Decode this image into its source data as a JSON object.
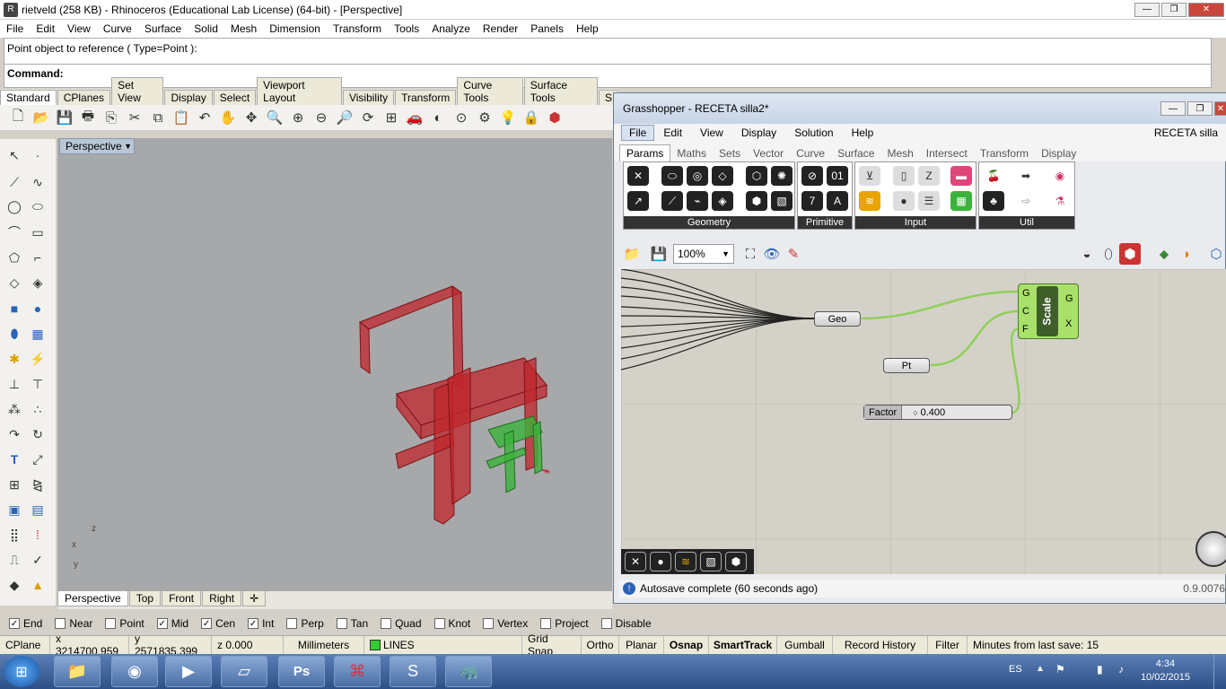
{
  "window": {
    "title": "rietveld (258 KB) - Rhinoceros (Educational Lab License) (64-bit) - [Perspective]"
  },
  "menu": [
    "File",
    "Edit",
    "View",
    "Curve",
    "Surface",
    "Solid",
    "Mesh",
    "Dimension",
    "Transform",
    "Tools",
    "Analyze",
    "Render",
    "Panels",
    "Help"
  ],
  "command": {
    "history": "Point object to reference ( Type=Point ):",
    "prompt": "Command:"
  },
  "toolbar_tabs": [
    "Standard",
    "CPlanes",
    "Set View",
    "Display",
    "Select",
    "Viewport Layout",
    "Visibility",
    "Transform",
    "Curve Tools",
    "Surface Tools",
    "S"
  ],
  "viewport": {
    "title": "Perspective",
    "tabs": [
      "Perspective",
      "Top",
      "Front",
      "Right"
    ],
    "axis_labels": {
      "z": "z",
      "x": "x",
      "y": "y"
    }
  },
  "osnap": [
    {
      "label": "End",
      "checked": true
    },
    {
      "label": "Near",
      "checked": false
    },
    {
      "label": "Point",
      "checked": false
    },
    {
      "label": "Mid",
      "checked": true
    },
    {
      "label": "Cen",
      "checked": true
    },
    {
      "label": "Int",
      "checked": true
    },
    {
      "label": "Perp",
      "checked": false
    },
    {
      "label": "Tan",
      "checked": false
    },
    {
      "label": "Quad",
      "checked": false
    },
    {
      "label": "Knot",
      "checked": false
    },
    {
      "label": "Vertex",
      "checked": false
    },
    {
      "label": "Project",
      "checked": false
    },
    {
      "label": "Disable",
      "checked": false
    }
  ],
  "status": {
    "cplane": "CPlane",
    "x": "x 3214700.959",
    "y": "y 2571835.399",
    "z": "z 0.000",
    "units": "Millimeters",
    "layer": "LINES",
    "layer_color": "#33cc33",
    "grid_snap": "Grid Snap",
    "ortho": "Ortho",
    "planar": "Planar",
    "osnap": "Osnap",
    "smarttrack": "SmartTrack",
    "gumball": "Gumball",
    "record_history": "Record History",
    "filter": "Filter",
    "last_save": "Minutes from last save: 15"
  },
  "grasshopper": {
    "title": "Grasshopper - RECETA silla2*",
    "doc_name": "RECETA silla",
    "menu": [
      "File",
      "Edit",
      "View",
      "Display",
      "Solution",
      "Help"
    ],
    "tabs": [
      "Params",
      "Maths",
      "Sets",
      "Vector",
      "Curve",
      "Surface",
      "Mesh",
      "Intersect",
      "Transform",
      "Display"
    ],
    "groups": [
      "Geometry",
      "Primitive",
      "Input",
      "Util"
    ],
    "zoom": "100%",
    "nodes": {
      "geo": "Geo",
      "pt": "Pt",
      "factor_label": "Factor",
      "factor_value": "0.400",
      "scale_title": "Scale",
      "scale_inputs": [
        "G",
        "C",
        "F"
      ],
      "scale_outputs": [
        "G",
        "X"
      ]
    },
    "status": "Autosave complete (60 seconds ago)",
    "version": "0.9.0076"
  },
  "taskbar": {
    "language": "ES",
    "time": "4:34",
    "date": "10/02/2015"
  },
  "colors": {
    "chair": "#c0262b",
    "chair_green": "#3cb33c",
    "scale_node": "#a8e06a",
    "wire": "#8fcf5a"
  }
}
